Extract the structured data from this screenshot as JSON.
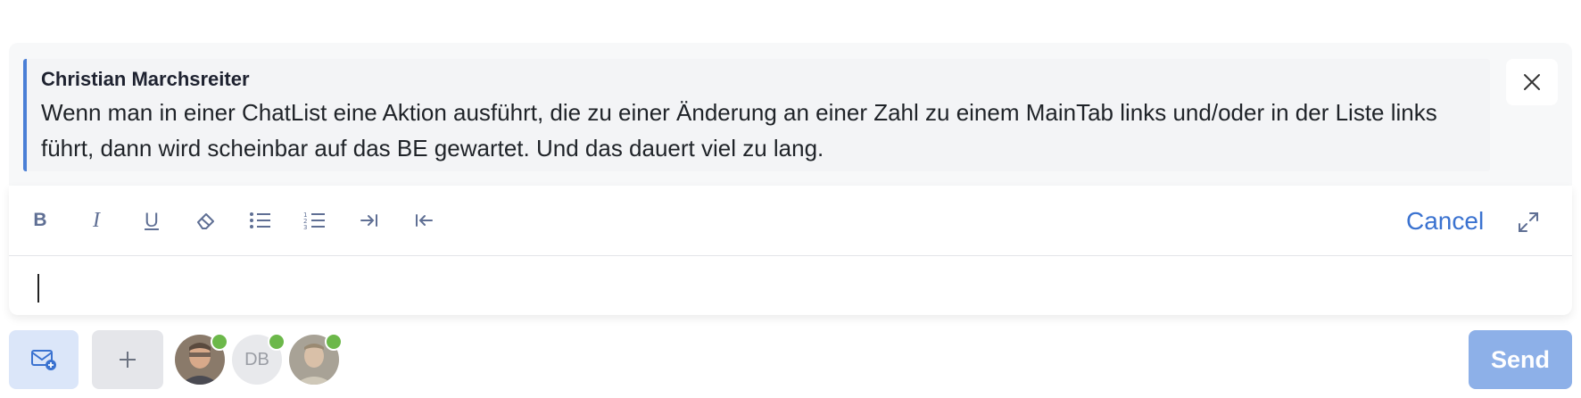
{
  "reply_quote": {
    "author": "Christian Marchsreiter",
    "text": "Wenn man in einer ChatList eine Aktion ausführt, die zu einer Änderung an einer Zahl zu einem MainTab links und/oder in der Liste links führt, dann wird scheinbar auf das BE gewartet. Und das dauert viel zu lang."
  },
  "toolbar": {
    "icons": [
      "bold-icon",
      "italic-icon",
      "underline-icon",
      "eraser-icon",
      "bullet-list-icon",
      "numbered-list-icon",
      "indent-icon",
      "outdent-icon"
    ],
    "bold_label": "B",
    "italic_label": "I",
    "underline_label": "U",
    "cancel_label": "Cancel"
  },
  "composer": {
    "value": ""
  },
  "participants": [
    {
      "type": "photo",
      "online": true
    },
    {
      "type": "initials",
      "initials": "DB",
      "online": true
    },
    {
      "type": "photo",
      "online": true
    }
  ],
  "actions": {
    "send_label": "Send"
  },
  "colors": {
    "accent": "#3a72d0",
    "quote_border": "#4a7fd6",
    "send_bg": "#8db0e8",
    "online": "#6cb84a"
  }
}
